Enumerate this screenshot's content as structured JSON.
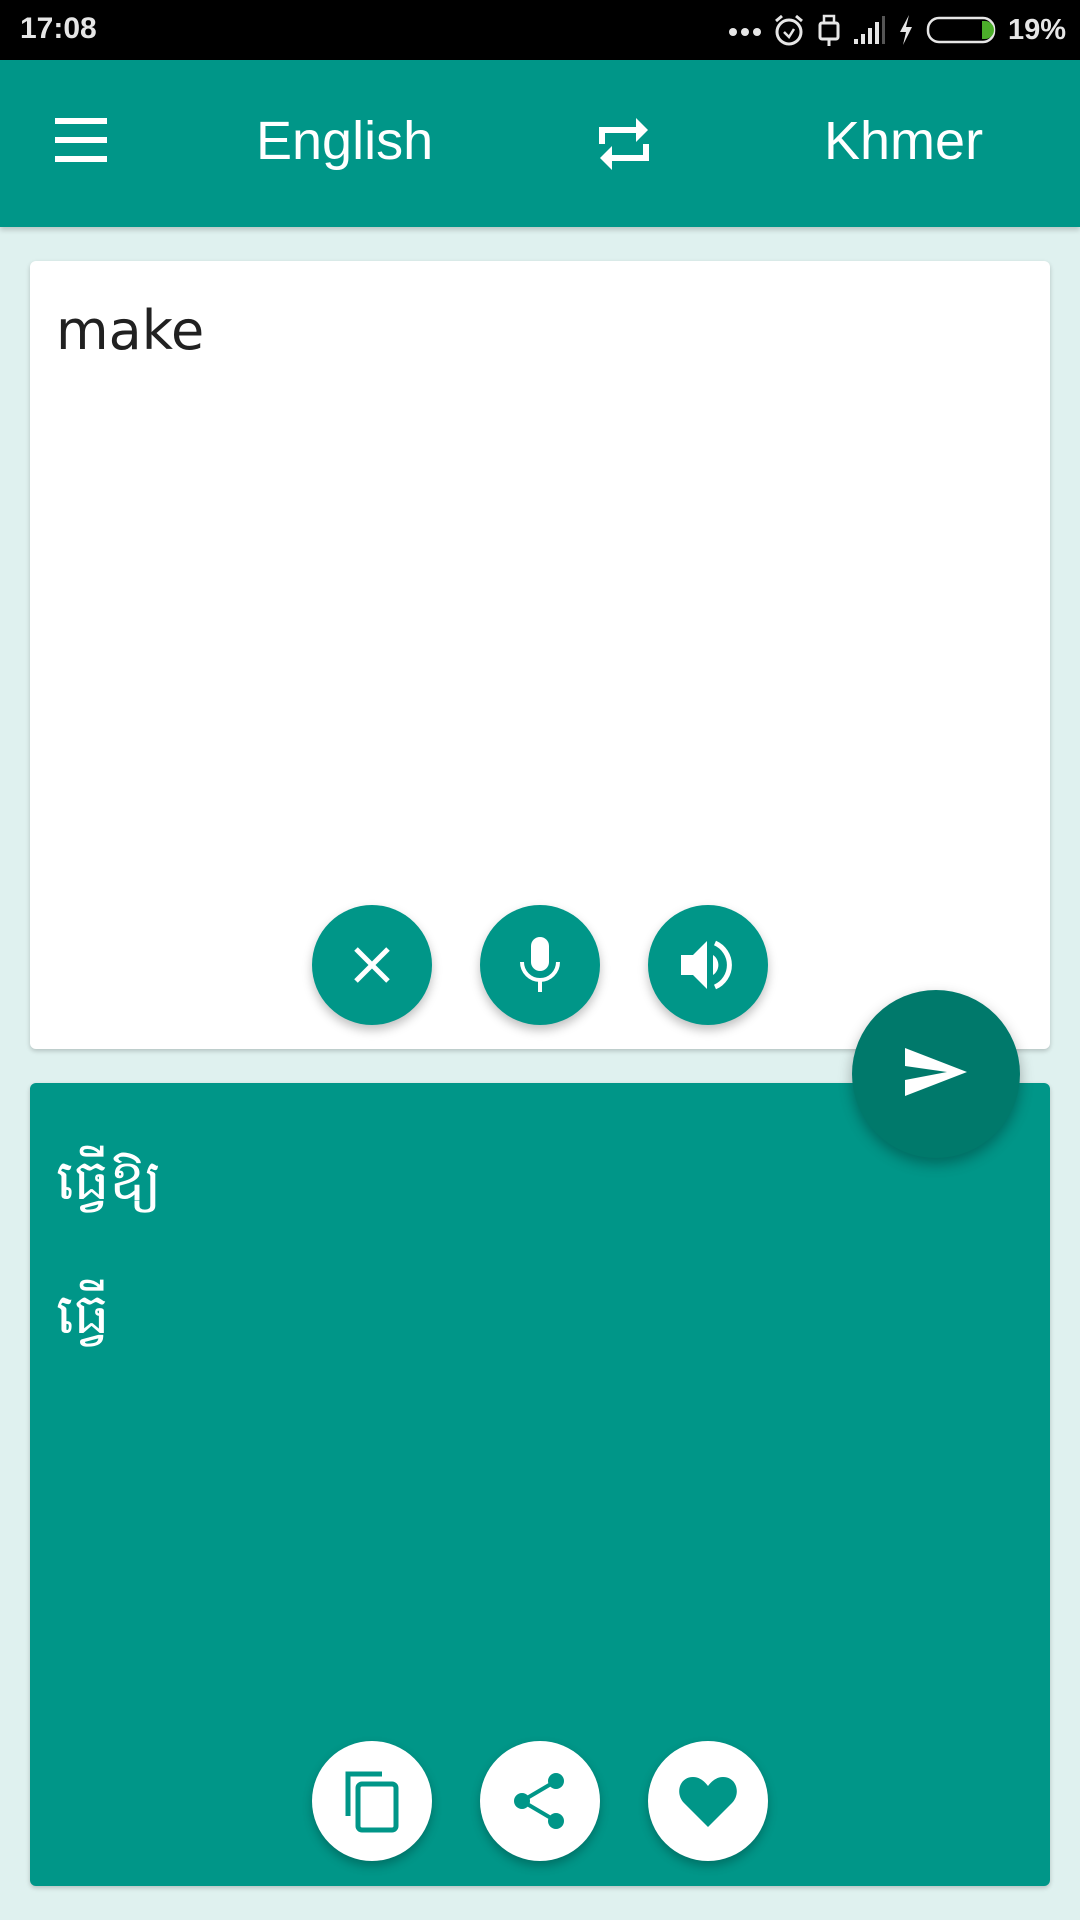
{
  "status_bar": {
    "time": "17:08",
    "battery_percent": "19%",
    "battery_level": 0.19,
    "icons": [
      "more-dots-icon",
      "alarm-icon",
      "usb-icon",
      "signal-icon",
      "charging-icon",
      "battery-icon"
    ]
  },
  "app_bar": {
    "menu_icon": "hamburger-menu-icon",
    "source_language": "English",
    "swap_icon": "swap-languages-icon",
    "target_language": "Khmer"
  },
  "input_card": {
    "text": "make",
    "buttons": [
      {
        "name": "clear",
        "icon": "close-icon"
      },
      {
        "name": "voice-input",
        "icon": "microphone-icon"
      },
      {
        "name": "speak",
        "icon": "speaker-icon"
      }
    ]
  },
  "translate_button": {
    "icon": "send-icon"
  },
  "output_card": {
    "lines": [
      "ធ្វើឱ្យ",
      "ធ្វើ"
    ],
    "buttons": [
      {
        "name": "copy",
        "icon": "copy-icon"
      },
      {
        "name": "share",
        "icon": "share-icon"
      },
      {
        "name": "favorite",
        "icon": "heart-icon"
      }
    ]
  },
  "colors": {
    "primary": "#009688",
    "primary_dark": "#00796b",
    "background": "#dff1ef"
  }
}
